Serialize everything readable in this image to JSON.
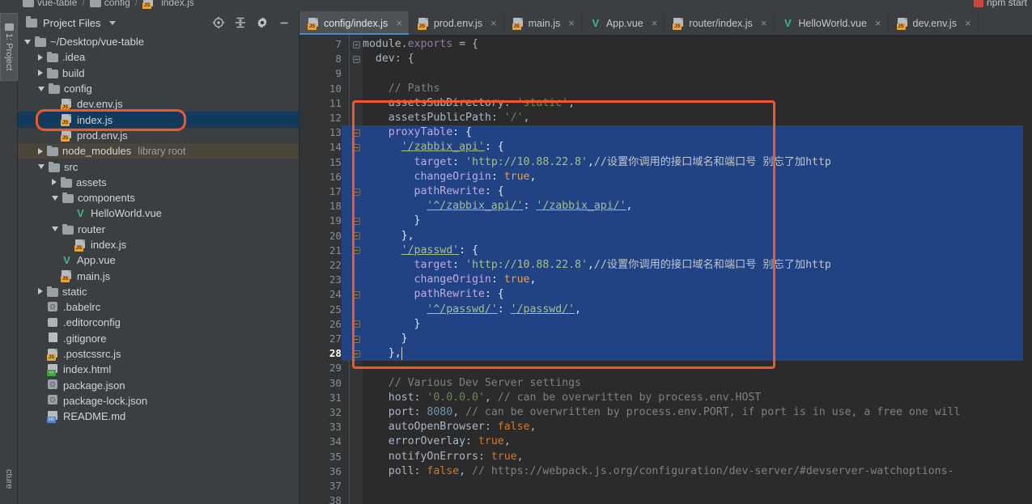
{
  "breadcrumb": {
    "items": [
      "vue-table",
      "config",
      "index.js"
    ],
    "separator": "/"
  },
  "run_config": {
    "label": "npm start"
  },
  "tool_windows": {
    "left_top": "1: Project",
    "left_bottom": "cture"
  },
  "project_panel": {
    "title": "Project Files",
    "tools": [
      {
        "name": "locate-icon",
        "label": "Select Opened File"
      },
      {
        "name": "collapse-all-icon",
        "label": "Collapse All"
      },
      {
        "name": "gear-icon",
        "label": "Settings"
      },
      {
        "name": "minimize-icon",
        "label": "Hide"
      }
    ],
    "tree": [
      {
        "label": "~/Desktop/vue-table",
        "indent": 0,
        "arrow": "down",
        "icon": "folder",
        "selected": false,
        "tag": ""
      },
      {
        "label": ".idea",
        "indent": 1,
        "arrow": "right",
        "icon": "folder",
        "selected": false,
        "tag": ""
      },
      {
        "label": "build",
        "indent": 1,
        "arrow": "right",
        "icon": "folder",
        "selected": false,
        "tag": ""
      },
      {
        "label": "config",
        "indent": 1,
        "arrow": "down",
        "icon": "folder",
        "selected": false,
        "tag": ""
      },
      {
        "label": "dev.env.js",
        "indent": 2,
        "arrow": "none",
        "icon": "js",
        "selected": false,
        "tag": ""
      },
      {
        "label": "index.js",
        "indent": 2,
        "arrow": "none",
        "icon": "js",
        "selected": true,
        "tag": ""
      },
      {
        "label": "prod.env.js",
        "indent": 2,
        "arrow": "none",
        "icon": "js",
        "selected": false,
        "tag": ""
      },
      {
        "label": "node_modules",
        "indent": 1,
        "arrow": "right",
        "icon": "folder",
        "selected": false,
        "tag": "library root"
      },
      {
        "label": "src",
        "indent": 1,
        "arrow": "down",
        "icon": "folder",
        "selected": false,
        "tag": ""
      },
      {
        "label": "assets",
        "indent": 2,
        "arrow": "right",
        "icon": "folder",
        "selected": false,
        "tag": ""
      },
      {
        "label": "components",
        "indent": 2,
        "arrow": "down",
        "icon": "folder",
        "selected": false,
        "tag": ""
      },
      {
        "label": "HelloWorld.vue",
        "indent": 3,
        "arrow": "none",
        "icon": "vue",
        "selected": false,
        "tag": ""
      },
      {
        "label": "router",
        "indent": 2,
        "arrow": "down",
        "icon": "folder",
        "selected": false,
        "tag": ""
      },
      {
        "label": "index.js",
        "indent": 3,
        "arrow": "none",
        "icon": "js",
        "selected": false,
        "tag": ""
      },
      {
        "label": "App.vue",
        "indent": 2,
        "arrow": "none",
        "icon": "vue",
        "selected": false,
        "tag": ""
      },
      {
        "label": "main.js",
        "indent": 2,
        "arrow": "none",
        "icon": "js",
        "selected": false,
        "tag": ""
      },
      {
        "label": "static",
        "indent": 1,
        "arrow": "right",
        "icon": "folder",
        "selected": false,
        "tag": ""
      },
      {
        "label": ".babelrc",
        "indent": 1,
        "arrow": "none",
        "icon": "json",
        "selected": false,
        "tag": ""
      },
      {
        "label": ".editorconfig",
        "indent": 1,
        "arrow": "none",
        "icon": "gear2",
        "selected": false,
        "tag": ""
      },
      {
        "label": ".gitignore",
        "indent": 1,
        "arrow": "none",
        "icon": "plain",
        "selected": false,
        "tag": ""
      },
      {
        "label": ".postcssrc.js",
        "indent": 1,
        "arrow": "none",
        "icon": "js",
        "selected": false,
        "tag": ""
      },
      {
        "label": "index.html",
        "indent": 1,
        "arrow": "none",
        "icon": "html",
        "selected": false,
        "tag": ""
      },
      {
        "label": "package.json",
        "indent": 1,
        "arrow": "none",
        "icon": "json",
        "selected": false,
        "tag": ""
      },
      {
        "label": "package-lock.json",
        "indent": 1,
        "arrow": "none",
        "icon": "json",
        "selected": false,
        "tag": ""
      },
      {
        "label": "README.md",
        "indent": 1,
        "arrow": "none",
        "icon": "md",
        "selected": false,
        "tag": ""
      }
    ]
  },
  "editor": {
    "tabs": [
      {
        "label": "config/index.js",
        "icon": "js",
        "active": true,
        "close": "×"
      },
      {
        "label": "prod.env.js",
        "icon": "js",
        "active": false,
        "close": "×"
      },
      {
        "label": "main.js",
        "icon": "js",
        "active": false,
        "close": "×"
      },
      {
        "label": "App.vue",
        "icon": "vue",
        "active": false,
        "close": "×"
      },
      {
        "label": "router/index.js",
        "icon": "js",
        "active": false,
        "close": "×"
      },
      {
        "label": "HelloWorld.vue",
        "icon": "vue",
        "active": false,
        "close": "×"
      },
      {
        "label": "dev.env.js",
        "icon": "js",
        "active": false,
        "close": "×"
      }
    ],
    "first_line_number": 7,
    "cursor_line": 28,
    "selection_lines": [
      13,
      28
    ],
    "lines": [
      {
        "n": 7,
        "fold": "−",
        "sel": false,
        "tokens": [
          {
            "t": "module",
            "c": "def"
          },
          {
            "t": ".",
            "c": "punc"
          },
          {
            "t": "exports",
            "c": "prop"
          },
          {
            "t": " = {",
            "c": "punc"
          }
        ]
      },
      {
        "n": 8,
        "fold": "−",
        "sel": false,
        "tokens": [
          {
            "t": "  ",
            "c": "punc"
          },
          {
            "t": "dev",
            "c": "def"
          },
          {
            "t": ": {",
            "c": "punc"
          }
        ]
      },
      {
        "n": 9,
        "fold": "",
        "sel": false,
        "tokens": []
      },
      {
        "n": 10,
        "fold": "",
        "sel": false,
        "tokens": [
          {
            "t": "    ",
            "c": "punc"
          },
          {
            "t": "// Paths",
            "c": "com"
          }
        ]
      },
      {
        "n": 11,
        "fold": "",
        "sel": false,
        "tokens": [
          {
            "t": "    ",
            "c": "punc"
          },
          {
            "t": "assetsSubDirectory",
            "c": "def"
          },
          {
            "t": ": ",
            "c": "punc"
          },
          {
            "t": "'static'",
            "c": "str"
          },
          {
            "t": ",",
            "c": "punc"
          }
        ]
      },
      {
        "n": 12,
        "fold": "",
        "sel": false,
        "tokens": [
          {
            "t": "    ",
            "c": "punc"
          },
          {
            "t": "assetsPublicPath",
            "c": "def"
          },
          {
            "t": ": ",
            "c": "punc"
          },
          {
            "t": "'/'",
            "c": "str"
          },
          {
            "t": ",",
            "c": "punc"
          }
        ]
      },
      {
        "n": 13,
        "fold": "−",
        "sel": true,
        "tokens": [
          {
            "t": "    ",
            "c": "punc"
          },
          {
            "t": "proxyTable",
            "c": "key"
          },
          {
            "t": ": {",
            "c": "punc"
          }
        ]
      },
      {
        "n": 14,
        "fold": "−",
        "sel": true,
        "tokens": [
          {
            "t": "      ",
            "c": "punc"
          },
          {
            "t": "'/zabbix_api'",
            "c": "str u"
          },
          {
            "t": ": {",
            "c": "punc"
          }
        ]
      },
      {
        "n": 15,
        "fold": "",
        "sel": true,
        "tokens": [
          {
            "t": "        ",
            "c": "punc"
          },
          {
            "t": "target",
            "c": "key"
          },
          {
            "t": ": ",
            "c": "punc"
          },
          {
            "t": "'http://10.88.22.8'",
            "c": "str"
          },
          {
            "t": ",",
            "c": "punc"
          },
          {
            "t": "//设置你调用的接口域名和端口号 别忘了加http",
            "c": "com"
          }
        ]
      },
      {
        "n": 16,
        "fold": "",
        "sel": true,
        "tokens": [
          {
            "t": "        ",
            "c": "punc"
          },
          {
            "t": "changeOrigin",
            "c": "key"
          },
          {
            "t": ": ",
            "c": "punc"
          },
          {
            "t": "true",
            "c": "kw"
          },
          {
            "t": ",",
            "c": "punc"
          }
        ]
      },
      {
        "n": 17,
        "fold": "−",
        "sel": true,
        "tokens": [
          {
            "t": "        ",
            "c": "punc"
          },
          {
            "t": "pathRewrite",
            "c": "key"
          },
          {
            "t": ": {",
            "c": "punc"
          }
        ]
      },
      {
        "n": 18,
        "fold": "",
        "sel": true,
        "tokens": [
          {
            "t": "          ",
            "c": "punc"
          },
          {
            "t": "'^/zabbix_api/'",
            "c": "str u"
          },
          {
            "t": ": ",
            "c": "punc"
          },
          {
            "t": "'/zabbix_api/'",
            "c": "str u"
          },
          {
            "t": ",",
            "c": "punc"
          }
        ]
      },
      {
        "n": 19,
        "fold": "−",
        "sel": true,
        "tokens": [
          {
            "t": "        }",
            "c": "punc"
          }
        ]
      },
      {
        "n": 20,
        "fold": "−",
        "sel": true,
        "tokens": [
          {
            "t": "      },",
            "c": "punc"
          }
        ]
      },
      {
        "n": 21,
        "fold": "−",
        "sel": true,
        "tokens": [
          {
            "t": "      ",
            "c": "punc"
          },
          {
            "t": "'/passwd'",
            "c": "str u"
          },
          {
            "t": ": {",
            "c": "punc"
          }
        ]
      },
      {
        "n": 22,
        "fold": "",
        "sel": true,
        "tokens": [
          {
            "t": "        ",
            "c": "punc"
          },
          {
            "t": "target",
            "c": "key"
          },
          {
            "t": ": ",
            "c": "punc"
          },
          {
            "t": "'http://10.88.22.8'",
            "c": "str"
          },
          {
            "t": ",",
            "c": "punc"
          },
          {
            "t": "//设置你调用的接口域名和端口号 别忘了加http",
            "c": "com"
          }
        ]
      },
      {
        "n": 23,
        "fold": "",
        "sel": true,
        "tokens": [
          {
            "t": "        ",
            "c": "punc"
          },
          {
            "t": "changeOrigin",
            "c": "key"
          },
          {
            "t": ": ",
            "c": "punc"
          },
          {
            "t": "true",
            "c": "kw"
          },
          {
            "t": ",",
            "c": "punc"
          }
        ]
      },
      {
        "n": 24,
        "fold": "−",
        "sel": true,
        "tokens": [
          {
            "t": "        ",
            "c": "punc"
          },
          {
            "t": "pathRewrite",
            "c": "key"
          },
          {
            "t": ": {",
            "c": "punc"
          }
        ]
      },
      {
        "n": 25,
        "fold": "",
        "sel": true,
        "tokens": [
          {
            "t": "          ",
            "c": "punc"
          },
          {
            "t": "'^/passwd/'",
            "c": "str u"
          },
          {
            "t": ": ",
            "c": "punc"
          },
          {
            "t": "'/passwd/'",
            "c": "str u"
          },
          {
            "t": ",",
            "c": "punc"
          }
        ]
      },
      {
        "n": 26,
        "fold": "−",
        "sel": true,
        "tokens": [
          {
            "t": "        }",
            "c": "punc"
          }
        ]
      },
      {
        "n": 27,
        "fold": "−",
        "sel": true,
        "tokens": [
          {
            "t": "      }",
            "c": "punc"
          }
        ]
      },
      {
        "n": 28,
        "fold": "−",
        "sel": true,
        "tokens": [
          {
            "t": "    },",
            "c": "punc"
          }
        ]
      },
      {
        "n": 29,
        "fold": "",
        "sel": false,
        "tokens": []
      },
      {
        "n": 30,
        "fold": "",
        "sel": false,
        "tokens": [
          {
            "t": "    ",
            "c": "punc"
          },
          {
            "t": "// Various Dev Server settings",
            "c": "com"
          }
        ]
      },
      {
        "n": 31,
        "fold": "",
        "sel": false,
        "tokens": [
          {
            "t": "    ",
            "c": "punc"
          },
          {
            "t": "host",
            "c": "def"
          },
          {
            "t": ": ",
            "c": "punc"
          },
          {
            "t": "'0.0.0.0'",
            "c": "str"
          },
          {
            "t": ", ",
            "c": "punc"
          },
          {
            "t": "// can be overwritten by process.env.HOST",
            "c": "com"
          }
        ]
      },
      {
        "n": 32,
        "fold": "",
        "sel": false,
        "tokens": [
          {
            "t": "    ",
            "c": "punc"
          },
          {
            "t": "port",
            "c": "def"
          },
          {
            "t": ": ",
            "c": "punc"
          },
          {
            "t": "8080",
            "c": "num"
          },
          {
            "t": ", ",
            "c": "punc"
          },
          {
            "t": "// can be overwritten by process.env.PORT, if port is in use, a free one will",
            "c": "com"
          }
        ]
      },
      {
        "n": 33,
        "fold": "",
        "sel": false,
        "tokens": [
          {
            "t": "    ",
            "c": "punc"
          },
          {
            "t": "autoOpenBrowser",
            "c": "def"
          },
          {
            "t": ": ",
            "c": "punc"
          },
          {
            "t": "false",
            "c": "kw"
          },
          {
            "t": ",",
            "c": "punc"
          }
        ]
      },
      {
        "n": 34,
        "fold": "",
        "sel": false,
        "tokens": [
          {
            "t": "    ",
            "c": "punc"
          },
          {
            "t": "errorOverlay",
            "c": "def"
          },
          {
            "t": ": ",
            "c": "punc"
          },
          {
            "t": "true",
            "c": "kw"
          },
          {
            "t": ",",
            "c": "punc"
          }
        ]
      },
      {
        "n": 35,
        "fold": "",
        "sel": false,
        "tokens": [
          {
            "t": "    ",
            "c": "punc"
          },
          {
            "t": "notifyOnErrors",
            "c": "def"
          },
          {
            "t": ": ",
            "c": "punc"
          },
          {
            "t": "true",
            "c": "kw"
          },
          {
            "t": ",",
            "c": "punc"
          }
        ]
      },
      {
        "n": 36,
        "fold": "",
        "sel": false,
        "tokens": [
          {
            "t": "    ",
            "c": "punc"
          },
          {
            "t": "poll",
            "c": "def"
          },
          {
            "t": ": ",
            "c": "punc"
          },
          {
            "t": "false",
            "c": "kw"
          },
          {
            "t": ", ",
            "c": "punc"
          },
          {
            "t": "// https://webpack.js.org/configuration/dev-server/#devserver-watchoptions-",
            "c": "com"
          }
        ]
      },
      {
        "n": 37,
        "fold": "",
        "sel": false,
        "tokens": []
      },
      {
        "n": 38,
        "fold": "",
        "sel": false,
        "tokens": []
      }
    ]
  },
  "annotations": {
    "tree_highlight": {
      "target": "index.js",
      "color": "#f4562a"
    },
    "code_highlight": {
      "from_line": 11,
      "to_line": 29,
      "color": "#f4562a"
    }
  },
  "colors": {
    "accent_orange": "#f4562a",
    "selection_blue": "#214283",
    "tree_selection": "#113a5c",
    "panel_bg": "#3c3f41",
    "editor_bg": "#2b2b2b",
    "gutter_bg": "#313335",
    "vue_green": "#41b883",
    "js_badge": "#e8a33d"
  }
}
